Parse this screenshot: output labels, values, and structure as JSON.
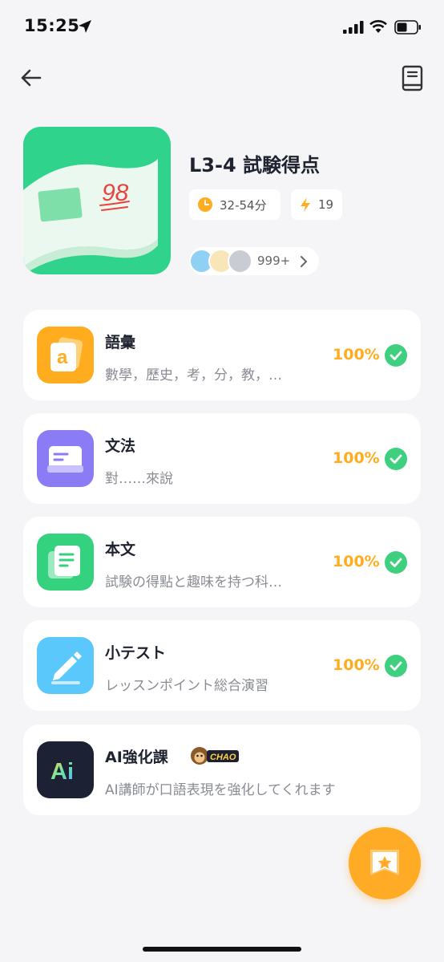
{
  "status_bar": {
    "time": "15:25",
    "icons": [
      "location-arrow-icon",
      "cellular-signal-icon",
      "wifi-icon",
      "battery-icon"
    ]
  },
  "nav": {
    "back_icon": "arrow-left-icon",
    "book_icon": "book-icon"
  },
  "lesson": {
    "cover_score": "98",
    "title": "L3-4 試験得点",
    "duration": "32-54分",
    "energy": "19",
    "learners_count": "999+"
  },
  "modules": [
    {
      "title": "語彙",
      "subtitle": "數學，歷史，考，分，教，…",
      "progress": "100%",
      "icon": "vocabulary-card-icon",
      "color": "#ffad1f"
    },
    {
      "title": "文法",
      "subtitle": "對……來說",
      "progress": "100%",
      "icon": "grammar-notebook-icon",
      "color": "#8b7cf6"
    },
    {
      "title": "本文",
      "subtitle": "試験の得點と趣味を持つ科…",
      "progress": "100%",
      "icon": "text-document-icon",
      "color": "#34d17f"
    },
    {
      "title": "小テスト",
      "subtitle": "レッスンポイント総合演習",
      "progress": "100%",
      "icon": "quiz-pencil-icon",
      "color": "#5ac8fa"
    },
    {
      "title": "AI強化課",
      "subtitle": "AI講師が口語表現を強化してくれます",
      "icon": "ai-logo-icon",
      "badge": "CHAO",
      "color": "#1c2233"
    }
  ],
  "colors": {
    "accent_orange": "#ffab25",
    "complete_green": "#3fd07f",
    "background": "#f5f5f7"
  },
  "fab": {
    "icon": "star-badge-icon"
  }
}
